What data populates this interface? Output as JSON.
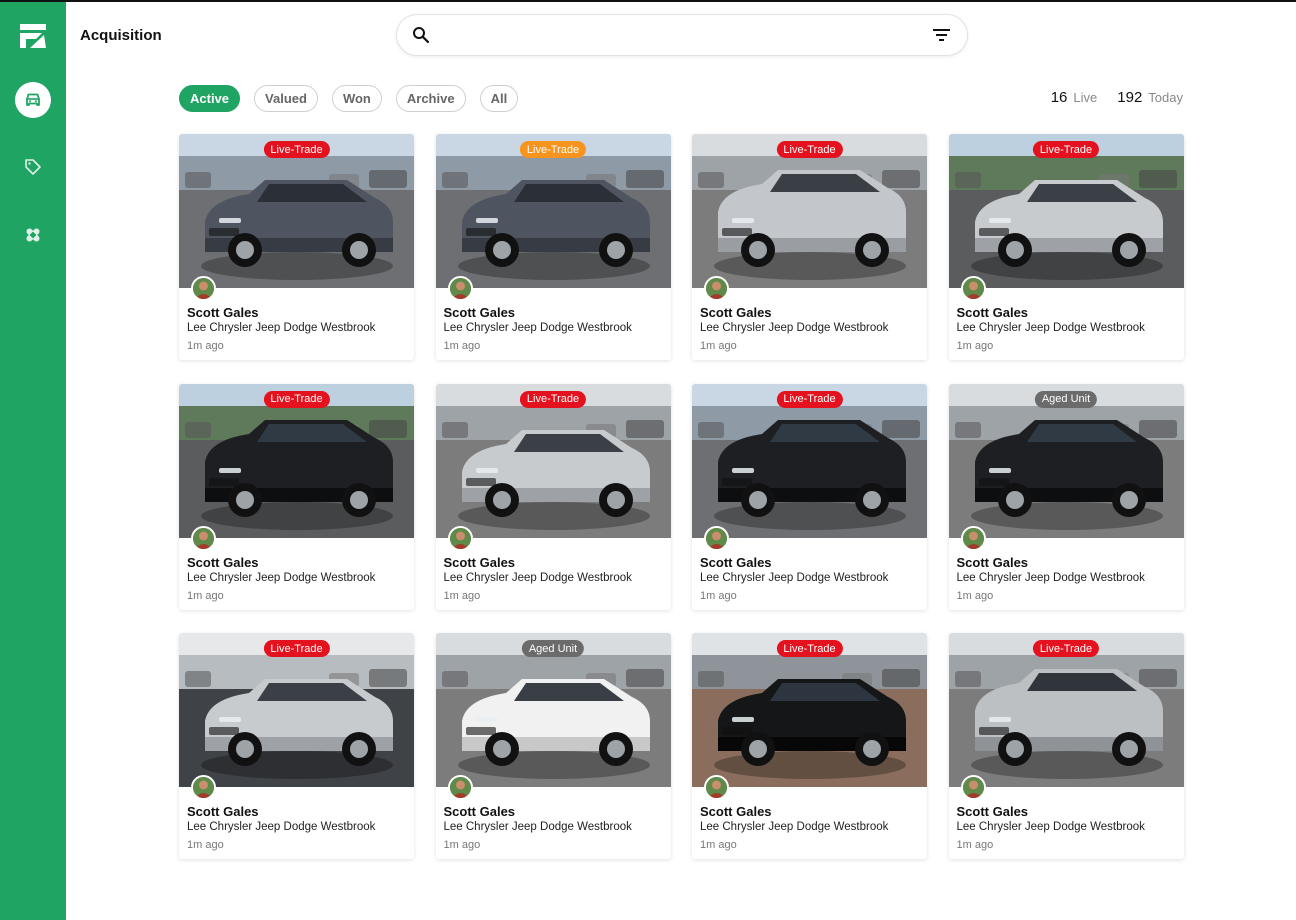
{
  "app": {
    "title": "Acquisition"
  },
  "search": {
    "placeholder": ""
  },
  "filters": [
    "Active",
    "Valued",
    "Won",
    "Archive",
    "All"
  ],
  "active_filter": "Active",
  "stats": {
    "live_count": "16",
    "live_label": "Live",
    "today_count": "192",
    "today_label": "Today"
  },
  "colors": {
    "brand": "#1fa463",
    "live_trade": "#e4121e",
    "live_trade_alt": "#f7941d",
    "aged_unit": "#6b6b6b"
  },
  "cards": [
    {
      "badge": "Live-Trade",
      "badge_color": "#e4121e",
      "car": "grey-sedan",
      "scene": "lot-blue",
      "name": "Scott Gales",
      "dealer": "Lee Chrysler Jeep Dodge Westbrook",
      "time": "1m ago"
    },
    {
      "badge": "Live-Trade",
      "badge_color": "#f7941d",
      "car": "grey-sedan",
      "scene": "lot-blue",
      "name": "Scott Gales",
      "dealer": "Lee Chrysler Jeep Dodge Westbrook",
      "time": "1m ago"
    },
    {
      "badge": "Live-Trade",
      "badge_color": "#e4121e",
      "car": "silver-suv",
      "scene": "lot-grey",
      "name": "Scott Gales",
      "dealer": "Lee Chrysler Jeep Dodge Westbrook",
      "time": "1m ago"
    },
    {
      "badge": "Live-Trade",
      "badge_color": "#e4121e",
      "car": "silver-coupe",
      "scene": "lot-green",
      "name": "Scott Gales",
      "dealer": "Lee Chrysler Jeep Dodge Westbrook",
      "time": "1m ago"
    },
    {
      "badge": "Live-Trade",
      "badge_color": "#e4121e",
      "car": "black-suv",
      "scene": "lot-green",
      "name": "Scott Gales",
      "dealer": "Lee Chrysler Jeep Dodge Westbrook",
      "time": "1m ago"
    },
    {
      "badge": "Live-Trade",
      "badge_color": "#e4121e",
      "car": "silver-coupe",
      "scene": "lot-grey",
      "name": "Scott Gales",
      "dealer": "Lee Chrysler Jeep Dodge Westbrook",
      "time": "1m ago"
    },
    {
      "badge": "Live-Trade",
      "badge_color": "#e4121e",
      "car": "black-suv",
      "scene": "lot-blue",
      "name": "Scott Gales",
      "dealer": "Lee Chrysler Jeep Dodge Westbrook",
      "time": "1m ago"
    },
    {
      "badge": "Aged Unit",
      "badge_color": "#6b6b6b",
      "car": "black-suv",
      "scene": "lot-grey",
      "name": "Scott Gales",
      "dealer": "Lee Chrysler Jeep Dodge Westbrook",
      "time": "1m ago"
    },
    {
      "badge": "Live-Trade",
      "badge_color": "#e4121e",
      "car": "silver-coupe",
      "scene": "lot-white",
      "name": "Scott Gales",
      "dealer": "Lee Chrysler Jeep Dodge Westbrook",
      "time": "1m ago"
    },
    {
      "badge": "Aged Unit",
      "badge_color": "#6b6b6b",
      "car": "white-sedan",
      "scene": "lot-grey",
      "name": "Scott Gales",
      "dealer": "Lee Chrysler Jeep Dodge Westbrook",
      "time": "1m ago"
    },
    {
      "badge": "Live-Trade",
      "badge_color": "#e4121e",
      "car": "black-sedan",
      "scene": "lot-brick",
      "name": "Scott Gales",
      "dealer": "Lee Chrysler Jeep Dodge Westbrook",
      "time": "1m ago"
    },
    {
      "badge": "Live-Trade",
      "badge_color": "#e4121e",
      "car": "silver-truck",
      "scene": "lot-grey",
      "name": "Scott Gales",
      "dealer": "Lee Chrysler Jeep Dodge Westbrook",
      "time": "1m ago"
    }
  ],
  "icons": {
    "logo": "brand-logo-icon",
    "nav": [
      "car-icon",
      "tag-icon",
      "bandage-icon"
    ],
    "search": "search-icon",
    "filter": "filter-icon"
  }
}
